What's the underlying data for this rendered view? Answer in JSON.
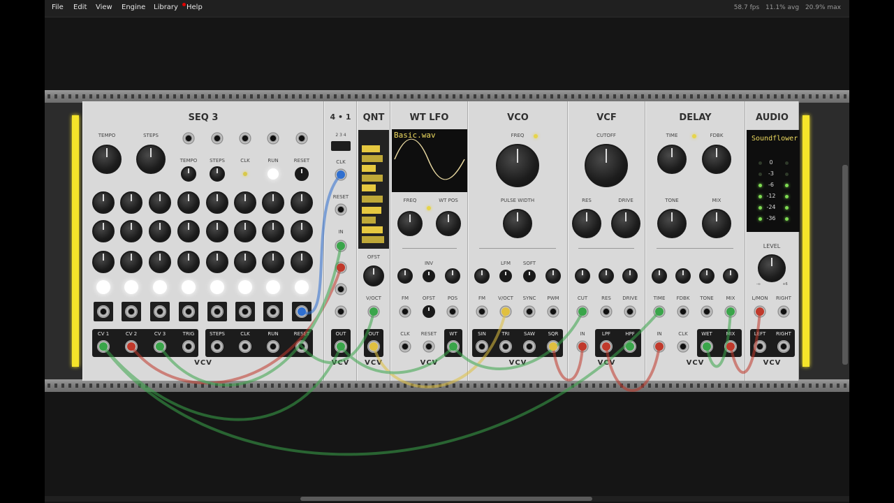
{
  "menu": {
    "file": "File",
    "edit": "Edit",
    "view": "View",
    "engine": "Engine",
    "library": "Library",
    "help": "Help"
  },
  "stats": {
    "fps": "58.7 fps",
    "avg": "11.1% avg",
    "max": "20.9% max"
  },
  "colors": {
    "accent_yellow": "#f5e42a",
    "cable_green": "#3aa54a",
    "cable_red": "#c0392b",
    "cable_yellow": "#e0c040",
    "cable_blue": "#2f6fd0",
    "led_green": "#7fdc52"
  },
  "seq3": {
    "title": "SEQ 3",
    "tempo": "TEMPO",
    "steps": "STEPS",
    "jack_tempo": "TEMPO",
    "jack_steps": "STEPS",
    "jack_clk": "CLK",
    "jack_run": "RUN",
    "jack_reset": "RESET",
    "out_labels": [
      "CV 1",
      "CV 2",
      "CV 3",
      "TRIG",
      "STEPS",
      "CLK",
      "RUN",
      "RESET"
    ],
    "logo": "VCV"
  },
  "mux": {
    "title": "4 • 1",
    "nums": "2  3  4",
    "clk": "CLK",
    "reset": "RESET",
    "in": "IN",
    "out": "OUT",
    "logo": "VCV"
  },
  "qnt": {
    "title": "QNT",
    "ofst": "OFST",
    "voct": "V/OCT",
    "out": "OUT",
    "logo": "VCV"
  },
  "wtlfo": {
    "title": "WT LFO",
    "file": "Basic.wav",
    "freq": "FREQ",
    "wtpos": "WT POS",
    "inv": "INV",
    "fm": "FM",
    "ofst": "OFST",
    "pos": "POS",
    "clk": "CLK",
    "reset": "RESET",
    "wt": "WT",
    "logo": "VCV"
  },
  "vco": {
    "title": "VCO",
    "freq": "FREQ",
    "pw": "PULSE WIDTH",
    "lfm": "LFM",
    "soft": "SOFT",
    "fm": "FM",
    "voct": "V/OCT",
    "sync": "SYNC",
    "pwm": "PWM",
    "sin": "SIN",
    "tri": "TRI",
    "saw": "SAW",
    "sqr": "SQR",
    "logo": "VCV"
  },
  "vcf": {
    "title": "VCF",
    "cutoff": "CUTOFF",
    "res": "RES",
    "drive": "DRIVE",
    "cut": "CUT",
    "res2": "RES",
    "drive2": "DRIVE",
    "in": "IN",
    "lpf": "LPF",
    "hpf": "HPF",
    "logo": "VCV"
  },
  "delay": {
    "title": "DELAY",
    "time": "TIME",
    "fdbk": "FDBK",
    "tone": "TONE",
    "mix": "MIX",
    "time2": "TIME",
    "fdbk2": "FDBK",
    "tone2": "TONE",
    "mix2": "MIX",
    "in": "IN",
    "clk": "CLK",
    "wet": "WET",
    "mix3": "MIX",
    "logo": "VCV"
  },
  "audio": {
    "title": "AUDIO",
    "device": "Soundflower",
    "vu": [
      "0",
      "-3",
      "-6",
      "-12",
      "-24",
      "-36"
    ],
    "level": "LEVEL",
    "min": "-∞",
    "max": "+6",
    "lmon": "L/MON",
    "right": "RIGHT",
    "left": "LEFT",
    "right2": "RIGHT",
    "logo": "VCV"
  }
}
